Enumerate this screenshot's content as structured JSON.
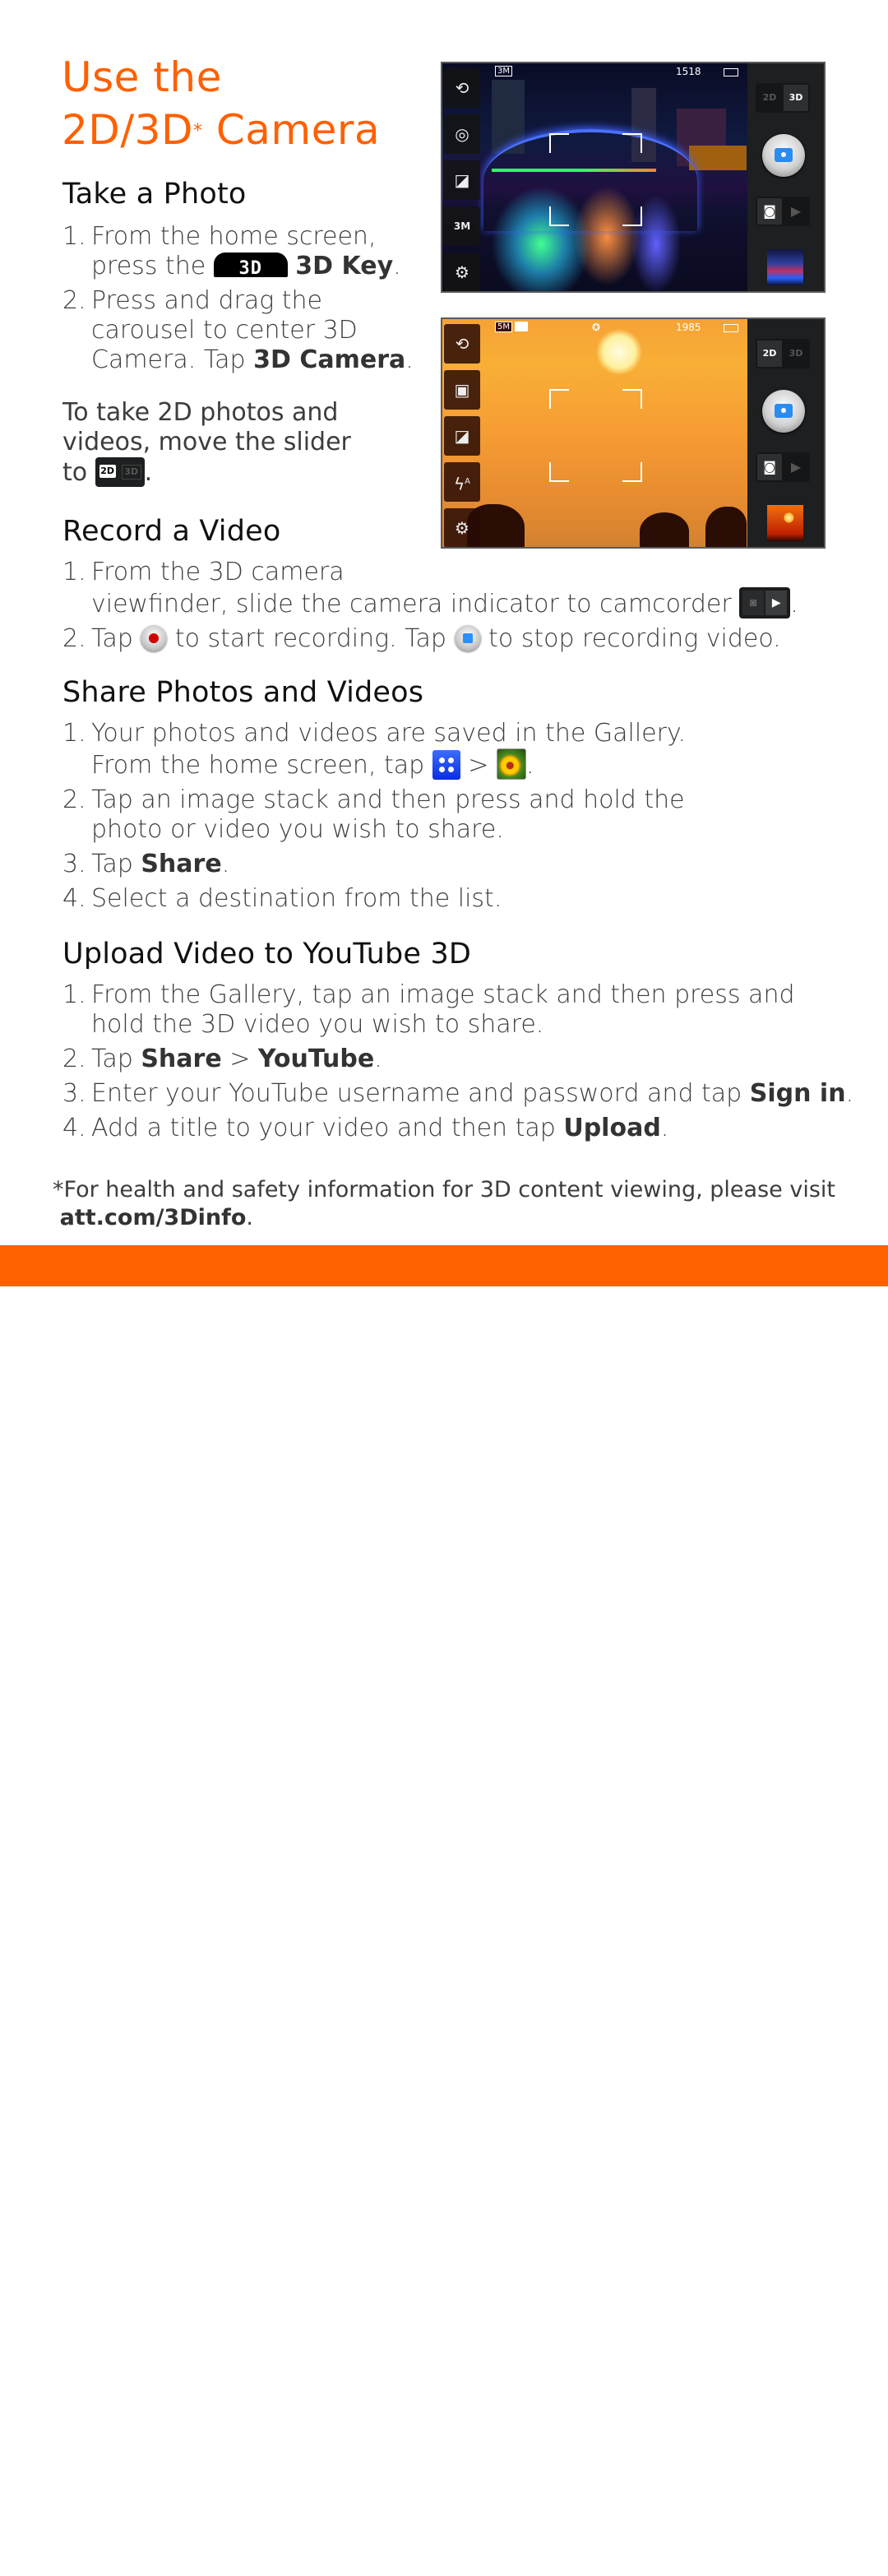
{
  "title": {
    "line1": "Use the",
    "line2": "2D/3D",
    "asterisk": "*",
    "line2_end": " Camera"
  },
  "colors": {
    "accent": "#ff6000",
    "heading": "#111111",
    "body": "#3d3d3d"
  },
  "take_photo": {
    "heading": "Take a Photo",
    "steps": [
      {
        "num": "1.",
        "text_a": "From the home screen,",
        "text_b": "press the ",
        "icon": "3d-key-icon",
        "icon_label": "3D",
        "bold": "3D Key",
        "end": "."
      },
      {
        "num": "2.",
        "text_a": "Press and drag the",
        "text_b": "carousel to center 3D",
        "text_c": "Camera. Tap ",
        "bold": "3D Camera",
        "end": "."
      }
    ],
    "note_a": "To take 2D photos and",
    "note_b": "videos, move the slider",
    "note_c": "to ",
    "note_icon": "2d-3d-slider-icon",
    "slider_labels": {
      "left": "2D",
      "right": "3D"
    },
    "note_end": "."
  },
  "record_video": {
    "heading": "Record a Video",
    "steps": [
      {
        "num": "1.",
        "text_a": "From the 3D camera",
        "text_b": "viewfinder, slide the camera indicator to camcorder ",
        "icon": "camcorder-indicator-icon",
        "end": "."
      },
      {
        "num": "2.",
        "text_a": "Tap ",
        "icon1": "record-button-icon",
        "text_b": " to start recording. Tap ",
        "icon2": "stop-button-icon",
        "text_c": " to stop recording video."
      }
    ]
  },
  "share": {
    "heading": "Share Photos and Videos",
    "steps": [
      {
        "num": "1.",
        "text_a": "Your photos and videos are saved in the Gallery.",
        "text_b": "From the home screen, tap ",
        "icon1": "apps-icon",
        "sep": " > ",
        "icon2": "gallery-icon",
        "end": "."
      },
      {
        "num": "2.",
        "text_a": "Tap an image stack and then press and hold the",
        "text_b": "photo or video you wish to share."
      },
      {
        "num": "3.",
        "text_a": "Tap ",
        "bold": "Share",
        "end": "."
      },
      {
        "num": "4.",
        "text_a": "Select a destination from the list."
      }
    ]
  },
  "youtube": {
    "heading": "Upload Video to YouTube 3D",
    "steps": [
      {
        "num": "1.",
        "text_a": "From the Gallery, tap an image stack and then press and",
        "text_b": "hold the 3D video you wish to share."
      },
      {
        "num": "2.",
        "text_a": "Tap ",
        "bold1": "Share",
        "sep": " > ",
        "bold2": "YouTube",
        "end": "."
      },
      {
        "num": "3.",
        "text_a": "Enter your YouTube username and password and tap ",
        "bold": "Sign in",
        "end": "."
      },
      {
        "num": "4.",
        "text_a": "Add a title to your video and then tap ",
        "bold": "Upload",
        "end": "."
      }
    ]
  },
  "footnote": {
    "text": "*For health and safety information for 3D content viewing, please visit",
    "link": "att.com/3Dinfo",
    "end": "."
  },
  "screenshot1": {
    "scene": "night city skyline with bridge",
    "status": {
      "resolution_badge": "3M",
      "shots_remaining": "1518",
      "battery": "battery-icon"
    },
    "left_buttons": [
      "camera-switch-icon",
      "effects-icon",
      "exposure-icon",
      "resolution-3m-icon",
      "settings-icon"
    ],
    "resolution_label": "3M",
    "mode_toggle": {
      "left": "2D",
      "right": "3D",
      "selected": "3D"
    },
    "capture_toggle": {
      "selected": "camera"
    }
  },
  "screenshot2": {
    "scene": "desert sunset with camels",
    "status": {
      "resolution_badge": "5M",
      "shots_remaining": "1985",
      "battery": "battery-icon"
    },
    "left_buttons": [
      "camera-switch-icon",
      "scene-mode-icon",
      "exposure-icon",
      "flash-auto-icon",
      "settings-icon"
    ],
    "flash_label": "A",
    "mode_toggle": {
      "left": "2D",
      "right": "3D",
      "selected": "2D"
    },
    "capture_toggle": {
      "selected": "camera"
    }
  }
}
